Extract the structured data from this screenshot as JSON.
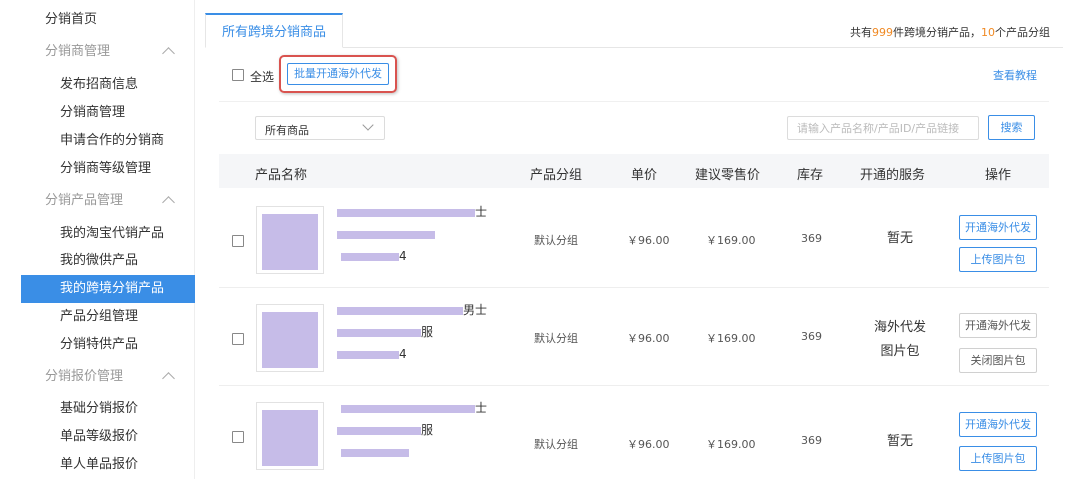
{
  "sidebar": {
    "items": [
      {
        "label": "分销首页",
        "kind": "top"
      },
      {
        "label": "分销商管理",
        "kind": "section"
      },
      {
        "label": "发布招商信息",
        "kind": "sub"
      },
      {
        "label": "分销商管理",
        "kind": "sub"
      },
      {
        "label": "申请合作的分销商",
        "kind": "sub"
      },
      {
        "label": "分销商等级管理",
        "kind": "sub"
      },
      {
        "label": "分销产品管理",
        "kind": "section"
      },
      {
        "label": "我的淘宝代销产品",
        "kind": "sub"
      },
      {
        "label": "我的微供产品",
        "kind": "sub"
      },
      {
        "label": "我的跨境分销产品",
        "kind": "sub",
        "active": true
      },
      {
        "label": "产品分组管理",
        "kind": "sub"
      },
      {
        "label": "分销特供产品",
        "kind": "sub"
      },
      {
        "label": "分销报价管理",
        "kind": "section"
      },
      {
        "label": "基础分销报价",
        "kind": "sub"
      },
      {
        "label": "单品等级报价",
        "kind": "sub"
      },
      {
        "label": "单人单品报价",
        "kind": "sub"
      }
    ]
  },
  "tabs": {
    "active_label": "所有跨境分销商品"
  },
  "summary": {
    "prefix": "共有",
    "product_count": "999",
    "middle": "件跨境分销产品，",
    "group_count": "10",
    "suffix": "个产品分组"
  },
  "toolbar": {
    "select_all_label": "全选",
    "batch_button_label": "批量开通海外代发",
    "tutorial_link": "查看教程"
  },
  "filter": {
    "select_value": "所有商品",
    "search_placeholder": "请输入产品名称/产品ID/产品链接",
    "search_button": "搜索"
  },
  "table": {
    "headers": {
      "name": "产品名称",
      "group": "产品分组",
      "price": "单价",
      "retail": "建议零售价",
      "stock": "库存",
      "services": "开通的服务",
      "actions": "操作"
    },
    "rows": [
      {
        "name_line1_tail": "士",
        "name_line2_tail": "",
        "name_line3_tail": "4",
        "group": "默认分组",
        "price": "￥96.00",
        "retail": "￥169.00",
        "stock": "369",
        "services_line1": "暂无",
        "services_line2": "",
        "action1": "开通海外代发",
        "action2": "上传图片包"
      },
      {
        "name_line1_tail": "男士",
        "name_line2_tail": "服",
        "name_line3_tail": "4",
        "group": "默认分组",
        "price": "￥96.00",
        "retail": "￥169.00",
        "stock": "369",
        "services_line1": "海外代发",
        "services_line2": "图片包",
        "action1": "开通海外代发",
        "action2": "关闭图片包"
      },
      {
        "name_line1_tail": "士",
        "name_line2_tail": "服",
        "name_line3_tail": "",
        "group": "默认分组",
        "price": "￥96.00",
        "retail": "￥169.00",
        "stock": "369",
        "services_line1": "暂无",
        "services_line2": "",
        "action1": "开通海外代发",
        "action2": "上传图片包"
      }
    ]
  },
  "colors": {
    "accent": "#3a8ee6",
    "highlight": "#f08a24",
    "annotation_box": "#d9534f",
    "redacted": "#c6bce8"
  }
}
